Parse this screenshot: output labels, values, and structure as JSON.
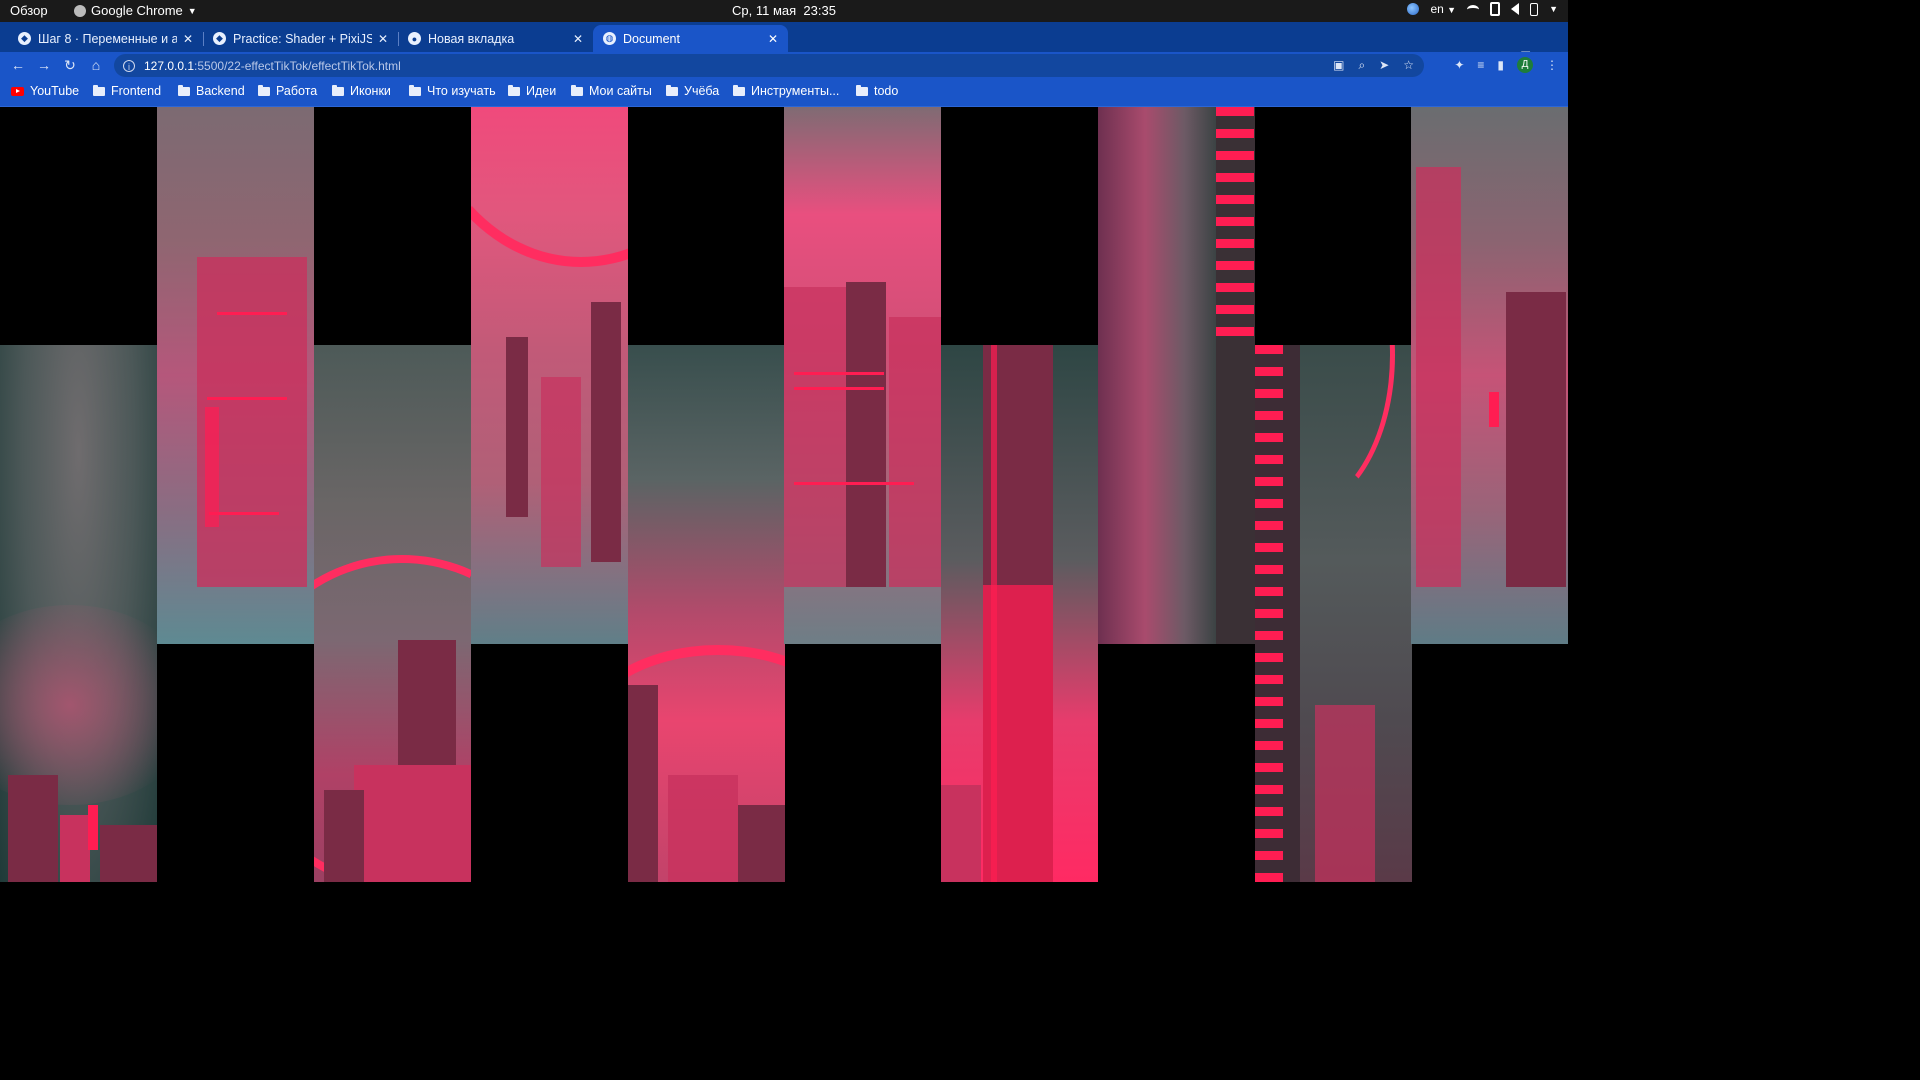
{
  "system_bar": {
    "overview": "Обзор",
    "app_name": "Google Chrome",
    "clock_date": "Ср, 11 мая",
    "clock_time": "23:35",
    "keyboard_layout": "en"
  },
  "tabs": [
    {
      "title": "Шаг 8 · Переменные и ар",
      "favicon": "codepen-icon",
      "active": false
    },
    {
      "title": "Practice: Shader + PixiJS F",
      "favicon": "codepen-icon",
      "active": false
    },
    {
      "title": "Новая вкладка",
      "favicon": "chrome-icon",
      "active": false
    },
    {
      "title": "Document",
      "favicon": "globe-icon",
      "active": true
    }
  ],
  "toolbar": {
    "url_host": "127.0.0.1",
    "url_path": ":5500/22-effectTikTok/effectTikTok.html",
    "profile_initial": "Д"
  },
  "bookmarks": [
    {
      "label": "YouTube",
      "icon": "youtube-icon"
    },
    {
      "label": "Frontend",
      "icon": "folder-icon"
    },
    {
      "label": "Backend",
      "icon": "folder-icon"
    },
    {
      "label": "Работа",
      "icon": "folder-icon"
    },
    {
      "label": "Иконки",
      "icon": "folder-icon"
    },
    {
      "label": "Что изучать",
      "icon": "folder-icon"
    },
    {
      "label": "Идеи",
      "icon": "folder-icon"
    },
    {
      "label": "Мои сайты",
      "icon": "folder-icon"
    },
    {
      "label": "Учёба",
      "icon": "folder-icon"
    },
    {
      "label": "Инструменты...",
      "icon": "folder-icon"
    },
    {
      "label": "todo",
      "icon": "folder-icon"
    }
  ],
  "colors": {
    "chrome_blue": "#1a55c8",
    "tabstrip_blue": "#0b3d91",
    "neon_pink": "#ff1d52",
    "teal": "#1f3a38"
  }
}
